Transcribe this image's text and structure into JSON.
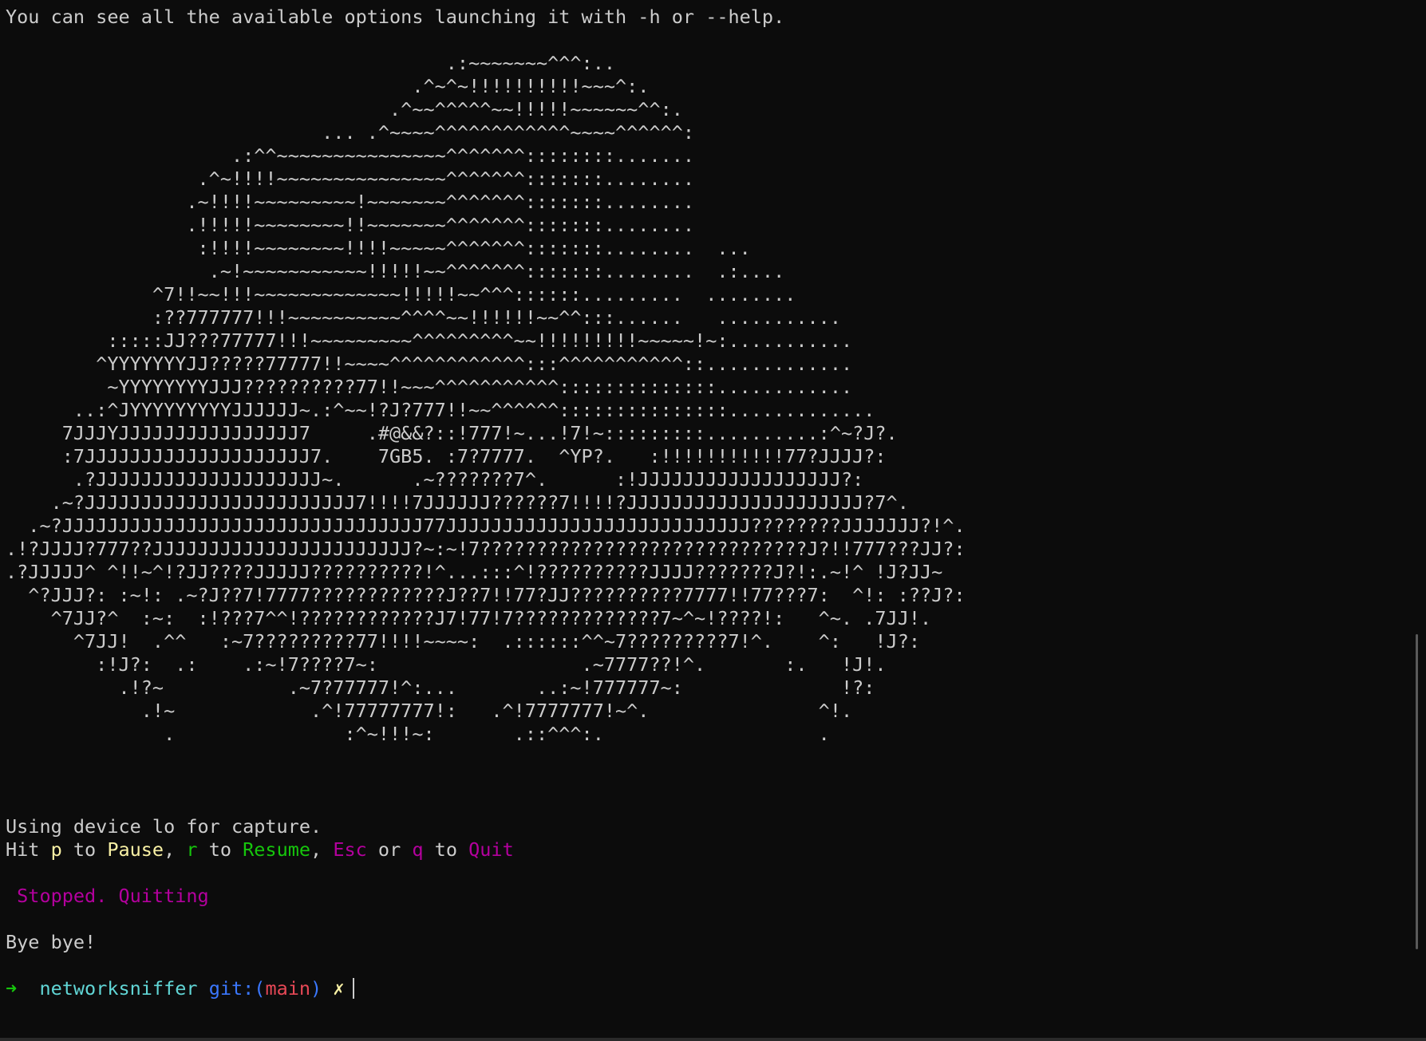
{
  "help_line": "You can see all the available options launching it with -h or --help.",
  "ascii_art": "                                       .:~~~~~~~^^^:..\n                                    .^~^~!!!!!!!!!!~~~^:.\n                                  .^~~^^^^^~~!!!!!~~~~~~^^:.\n                            ... .^~~~~^^^^^^^^^^^^~~~~^^^^^^:\n                    .:^^~~~~~~~~~~~~~~~^^^^^^^::::::::.......\n                 .^~!!!!~~~~~~~~~~~~~~~^^^^^^^:::::::........\n                .~!!!!~~~~~~~~~!~~~~~~~^^^^^^^:::::::........\n                .!!!!!~~~~~~~~!!~~~~~~~^^^^^^^:::::::........\n                 :!!!!~~~~~~~~!!!!~~~~~^^^^^^^:::::::........  ...\n                  .~!~~~~~~~~~~~!!!!!~~^^^^^^^:::::::........  .:....\n             ^7!!~~!!!~~~~~~~~~~~~~!!!!!~~^^^::::::.........  ........\n             :??777777!!!~~~~~~~~~~^^^^~~!!!!!!~~^^:::......   ...........\n         :::::JJ???77777!!!~~~~~~~~~^^^^^^^^^~~!!!!!!!!!~~~~~!~:...........\n        ^YYYYYYYJJ?????77777!!~~~~^^^^^^^^^^^^:::^^^^^^^^^^^::.............\n         ~YYYYYYYYJJJ??????????77!!~~~^^^^^^^^^^^::::::::::::::............\n      ..:^JYYYYYYYYYJJJJJJ~.:^~~!?J?777!!~~^^^^^^:::::::::::::::.............\n     7JJJYJJJJJJJJJJJJJJJJ7     .#@&&?::!777!~...!7!~:::::::::..........:^~?J?.\n     :7JJJJJJJJJJJJJJJJJJJJ7.    7GB5. :7?7777.  ^YP?.   :!!!!!!!!!!!77?JJJJ?:\n      .?JJJJJJJJJJJJJJJJJJJJ~.      .~???????7^.      :!JJJJJJJJJJJJJJJJJJ?:\n    .~?JJJJJJJJJJJJJJJJJJJJJJJJ7!!!!7JJJJJJ??????7!!!!?JJJJJJJJJJJJJJJJJJJJJ?7^.\n  .~?JJJJJJJJJJJJJJJJJJJJJJJJJJJJJJJJ77JJJJJJJJJJJJJJJJJJJJJJJJJJJ????????JJJJJJJ?!^.\n.!?JJJJ?777??JJJJJJJJJJJJJJJJJJJJJJJ?~:~!7?????????????????????????????J?!!777???JJ?:\n.?JJJJJ^ ^!!~^!?JJ????JJJJJ??????????!^...:::^!??????????JJJJ???????J?!:.~!^ !J?JJ~\n  ^?JJJ?: :~!: .~?J??7!7777????????????J??7!!77?JJ??????????7777!!77???7:  ^!: :??J?:\n    ^7JJ?^  :~:  :!???7^^!????????????J7!77!7?????????????7~^~!????!:   ^~. .7JJ!.\n      ^7JJ!  .^^   :~7?????????77!!!!~~~~:  .::::::^^~7?????????7!^.    ^:   !J?:\n        :!J?:  .:    .:~!7????7~:                  .~7777??!^.       :.   !J!.\n          .!?~           .~7?77777!^:...       ..:~!777777~:              !?:\n            .!~            .^!77777777!:   .^!7777777!~^.               ^!.\n              .               :^~!!!~:       .::^^^:.                   .",
  "capture_line": "Using device lo for capture.",
  "controls": {
    "hit": "Hit ",
    "p_key": "p",
    "to1": " to ",
    "pause": "Pause",
    "comma1": ", ",
    "r_key": "r",
    "to2": " to ",
    "resume": "Resume",
    "comma2": ", ",
    "esc_key": "Esc",
    "or": " or ",
    "q_key": "q",
    "to3": " to ",
    "quit": "Quit"
  },
  "stopped_line": " Stopped. Quitting",
  "bye_line": "Bye bye!",
  "prompt": {
    "arrow": "➜",
    "directory": "networksniffer",
    "git_label": "git:(",
    "branch": "main",
    "git_close": ")",
    "dirty_mark": "✗"
  },
  "colors": {
    "background": "#0c0c0c",
    "foreground": "#cccccc",
    "yellow": "#f9f1a5",
    "green": "#16c60c",
    "magenta": "#b4009e",
    "cyan": "#61d6d6",
    "blue": "#3b78ff",
    "red": "#e74856"
  }
}
